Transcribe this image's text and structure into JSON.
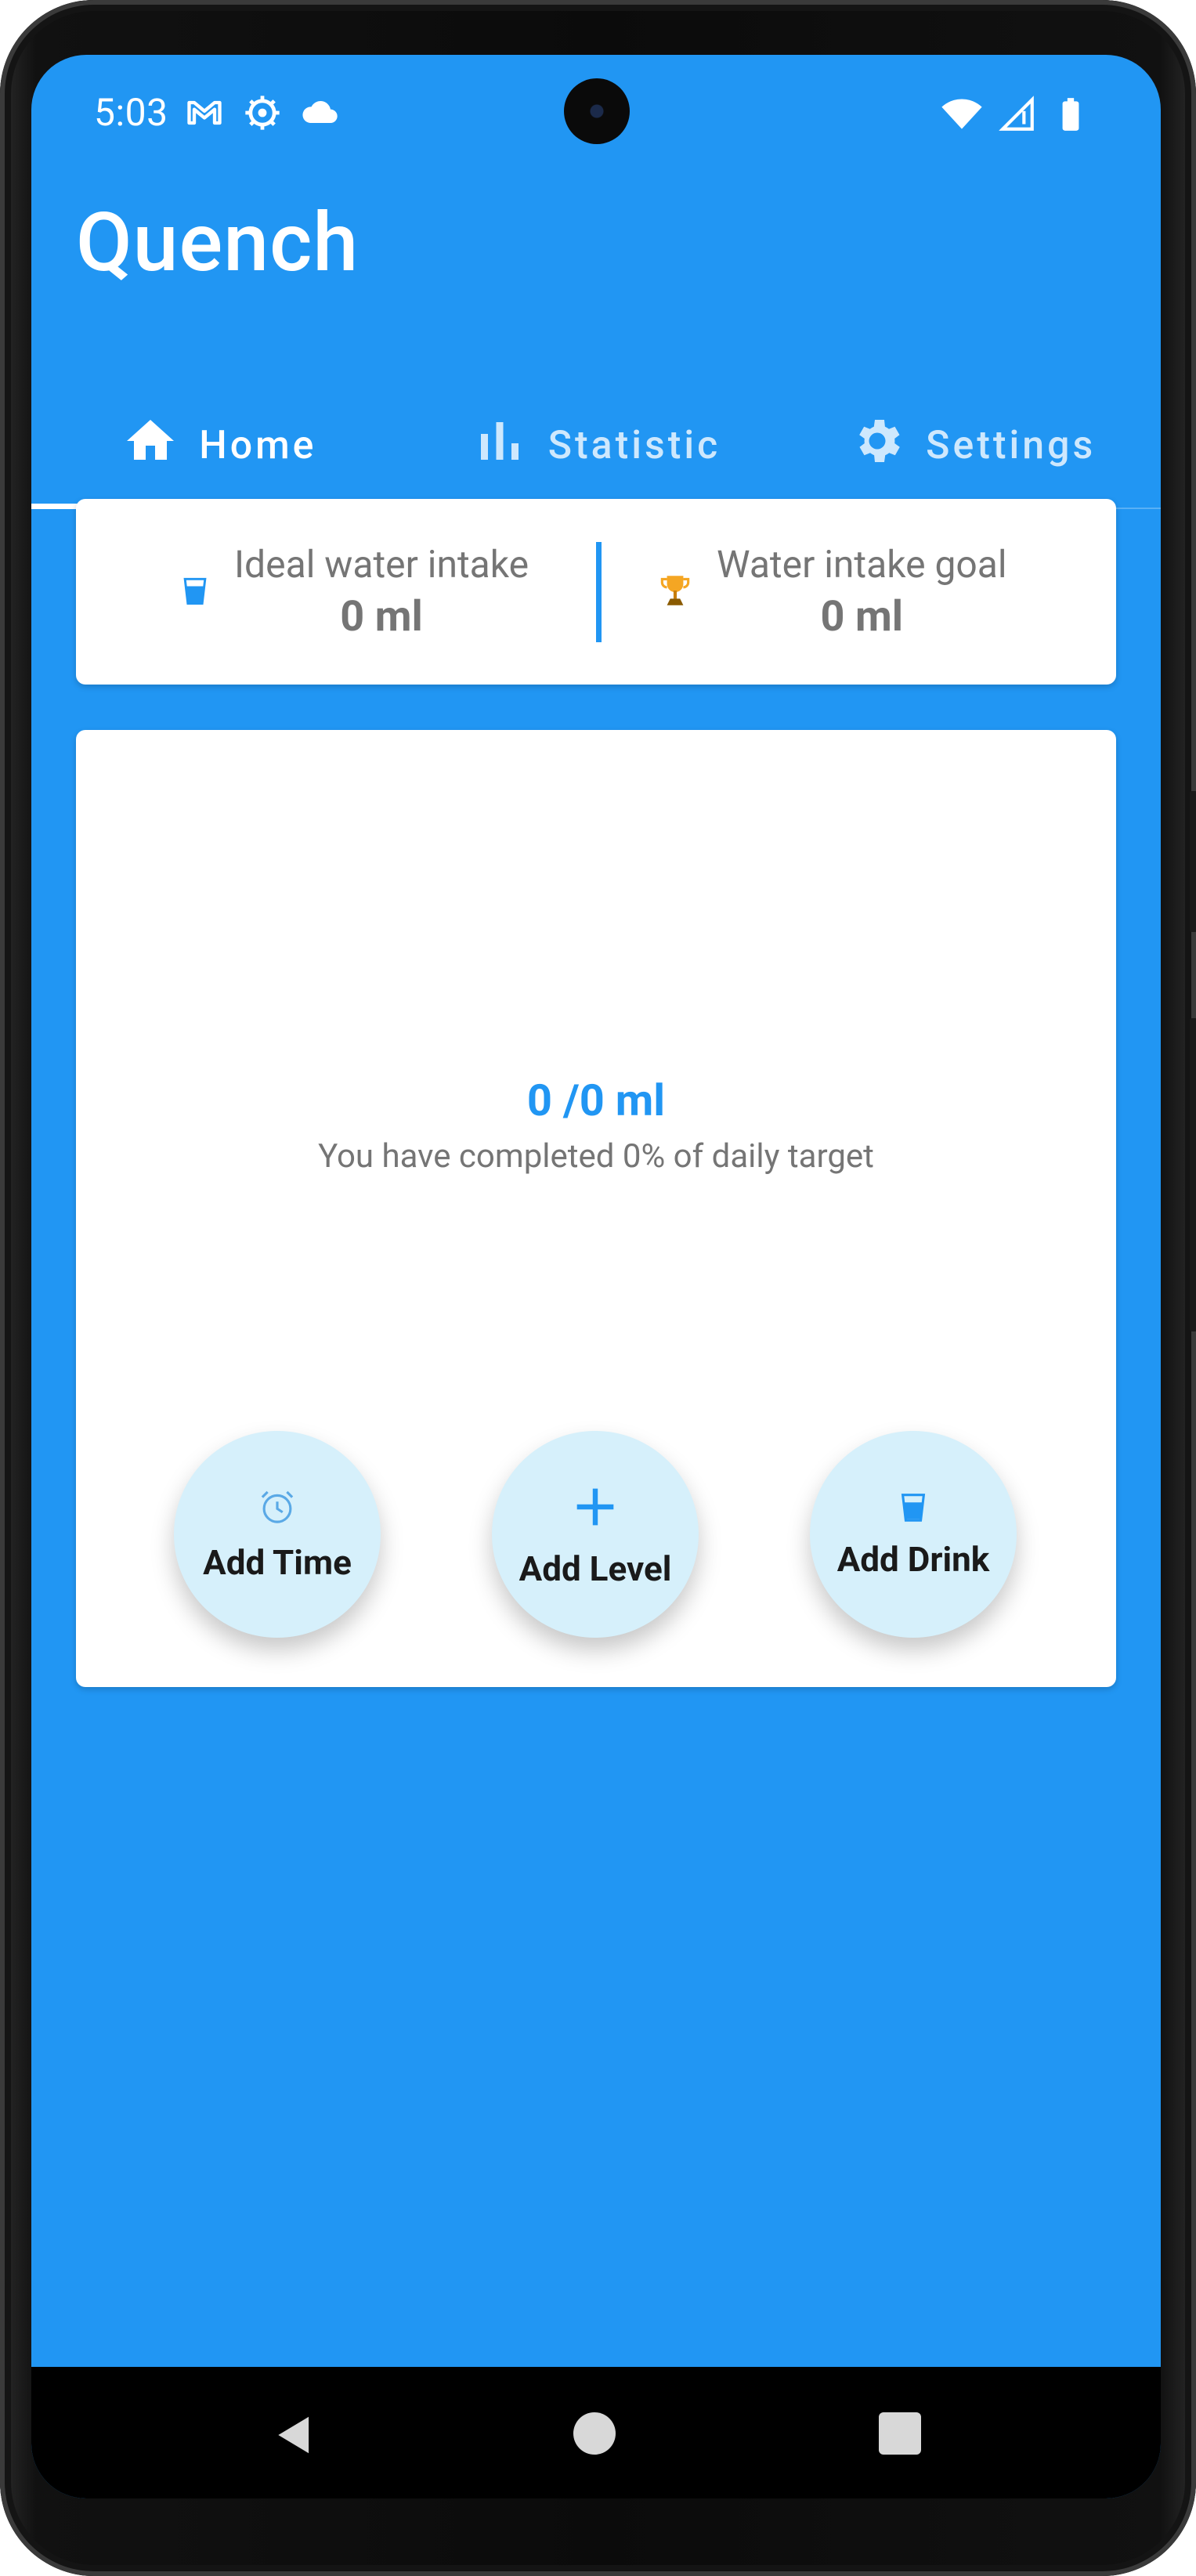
{
  "status_bar": {
    "time": "5:03",
    "left_icons": [
      "gmail-icon",
      "settings-sync-icon",
      "cloud-icon"
    ],
    "right_icons": [
      "wifi-icon",
      "signal-icon",
      "battery-icon"
    ]
  },
  "app": {
    "title": "Quench"
  },
  "tabs": [
    {
      "label": "Home",
      "icon": "home-icon",
      "active": true
    },
    {
      "label": "Statistic",
      "icon": "bar-chart-icon",
      "active": false
    },
    {
      "label": "Settings",
      "icon": "gear-icon",
      "active": false
    }
  ],
  "intake": {
    "ideal": {
      "label": "Ideal water intake",
      "value": "0 ml",
      "icon": "water-glass-icon"
    },
    "goal": {
      "label": "Water intake goal",
      "value": "0 ml",
      "icon": "trophy-icon"
    }
  },
  "progress": {
    "value": "0 /0 ml",
    "description": "You have completed 0% of daily target"
  },
  "actions": [
    {
      "label": "Add Time",
      "icon": "alarm-clock-icon"
    },
    {
      "label": "Add Level",
      "icon": "plus-icon"
    },
    {
      "label": "Add Drink",
      "icon": "water-glass-icon"
    }
  ],
  "colors": {
    "primary": "#2196f3",
    "button_bg": "#d6f0fb",
    "text_grey": "#757575",
    "trophy": "#f5a623"
  }
}
